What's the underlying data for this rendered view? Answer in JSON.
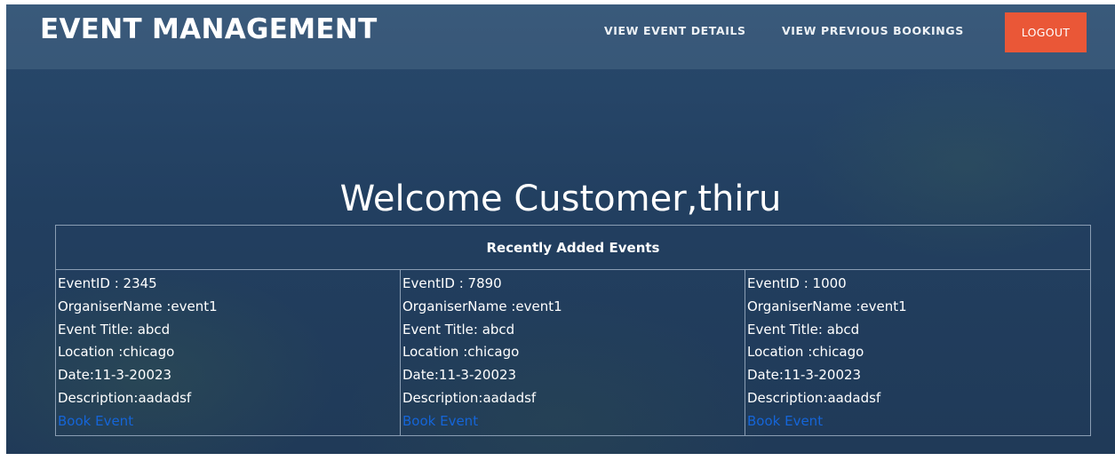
{
  "header": {
    "brand": "EVENT MANAGEMENT",
    "nav": {
      "view_event_details": "VIEW EVENT DETAILS",
      "view_previous_bookings": "VIEW PREVIOUS BOOKINGS"
    },
    "logout_label": "LOGOUT"
  },
  "welcome": "Welcome Customer,thiru",
  "events_section": {
    "title": "Recently Added Events",
    "events": [
      {
        "event_id": "EventID : 2345",
        "organiser": "OrganiserName :event1",
        "title": "Event Title: abcd",
        "location": "Location :chicago",
        "date": "Date:11-3-20023",
        "description": "Description:aadadsf",
        "book_label": "Book Event"
      },
      {
        "event_id": "EventID : 7890",
        "organiser": "OrganiserName :event1",
        "title": "Event Title: abcd",
        "location": "Location :chicago",
        "date": "Date:11-3-20023",
        "description": "Description:aadadsf",
        "book_label": "Book Event"
      },
      {
        "event_id": "EventID : 1000",
        "organiser": "OrganiserName :event1",
        "title": "Event Title: abcd",
        "location": "Location :chicago",
        "date": "Date:11-3-20023",
        "description": "Description:aadadsf",
        "book_label": "Book Event"
      }
    ]
  },
  "colors": {
    "background": "#223f60",
    "navbar": "#3d5f82",
    "logout_button": "#ea5737",
    "link": "#1565d8",
    "text": "#ffffff"
  }
}
